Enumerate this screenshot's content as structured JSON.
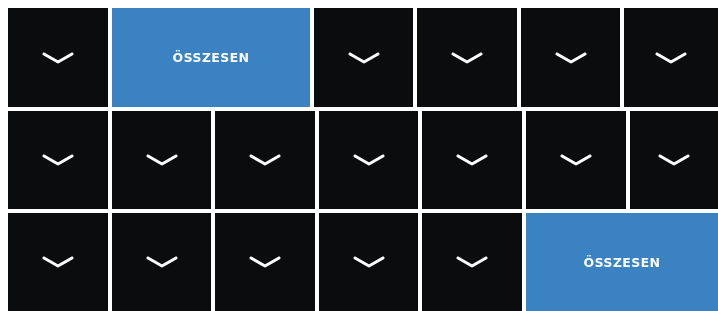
{
  "colors": {
    "tile_dark": "#0b0c0e",
    "tile_accent": "#3a82c2",
    "background": "#ffffff",
    "glyph": "#ffffff"
  },
  "rows": [
    {
      "tiles": [
        {
          "kind": "dropdown",
          "icon": "chevron-down-icon"
        },
        {
          "kind": "total",
          "label": "ÖSSZESEN"
        },
        {
          "kind": "dropdown",
          "icon": "chevron-down-icon"
        },
        {
          "kind": "dropdown",
          "icon": "chevron-down-icon"
        },
        {
          "kind": "dropdown",
          "icon": "chevron-down-icon"
        },
        {
          "kind": "dropdown",
          "icon": "chevron-down-icon"
        }
      ]
    },
    {
      "tiles": [
        {
          "kind": "dropdown",
          "icon": "chevron-down-icon"
        },
        {
          "kind": "dropdown",
          "icon": "chevron-down-icon"
        },
        {
          "kind": "dropdown",
          "icon": "chevron-down-icon"
        },
        {
          "kind": "dropdown",
          "icon": "chevron-down-icon"
        },
        {
          "kind": "dropdown",
          "icon": "chevron-down-icon"
        },
        {
          "kind": "dropdown",
          "icon": "chevron-down-icon"
        },
        {
          "kind": "dropdown",
          "icon": "chevron-down-icon"
        }
      ]
    },
    {
      "tiles": [
        {
          "kind": "dropdown",
          "icon": "chevron-down-icon"
        },
        {
          "kind": "dropdown",
          "icon": "chevron-down-icon"
        },
        {
          "kind": "dropdown",
          "icon": "chevron-down-icon"
        },
        {
          "kind": "dropdown",
          "icon": "chevron-down-icon"
        },
        {
          "kind": "dropdown",
          "icon": "chevron-down-icon"
        },
        {
          "kind": "total",
          "label": "ÖSSZESEN"
        }
      ]
    }
  ]
}
